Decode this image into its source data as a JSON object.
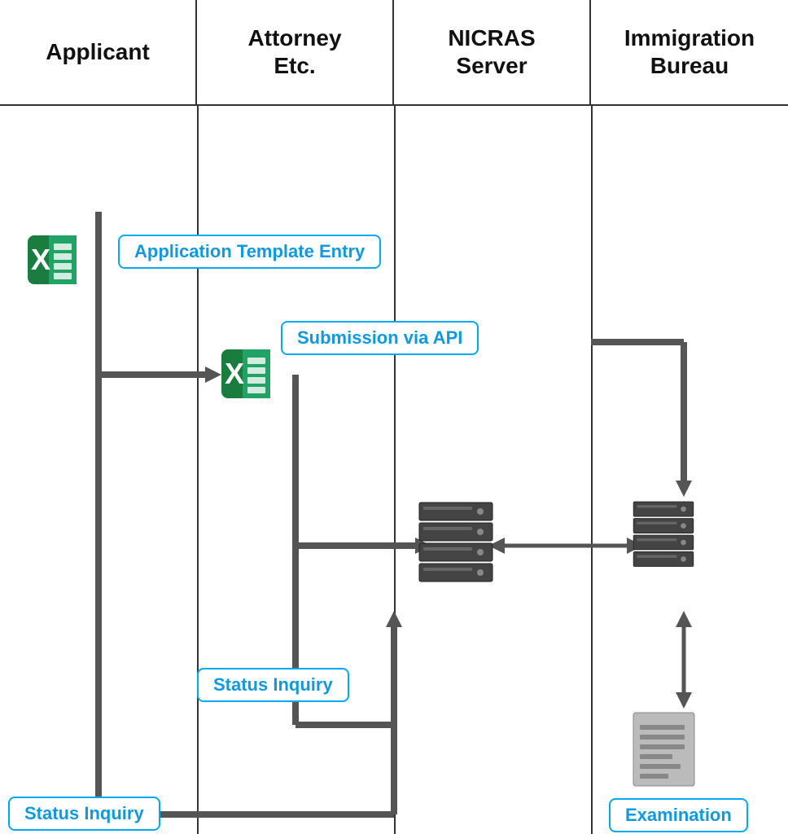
{
  "headers": {
    "col1": "Applicant",
    "col2": "Attorney\nEtc.",
    "col3": "NICRAS\nServer",
    "col4": "Immigration\nBureau"
  },
  "labels": {
    "app_template": "Application Template Entry",
    "submission": "Submission via API",
    "status_inquiry_mid": "Status Inquiry",
    "status_inquiry_bot": "Status Inquiry",
    "examination": "Examination"
  },
  "colors": {
    "border": "#333333",
    "label_border": "#00aaee",
    "label_text": "#1199dd",
    "arrow": "#555555"
  }
}
